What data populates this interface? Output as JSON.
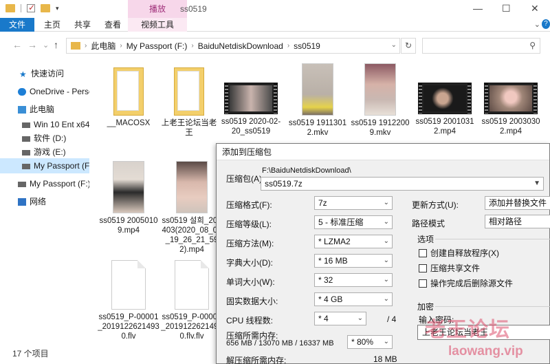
{
  "window": {
    "title": "ss0519",
    "context_tab": "播放",
    "min": "—",
    "max": "☐",
    "close": "✕"
  },
  "ribbon": {
    "tabs": [
      "文件",
      "主页",
      "共享",
      "查看",
      "视频工具"
    ],
    "help": "?",
    "chevron": "⌄"
  },
  "nav": {
    "back": "←",
    "forward": "→",
    "recent": "⌄",
    "up": "↑",
    "breadcrumbs": [
      "此电脑",
      "My Passport (F:)",
      "BaiduNetdiskDownload",
      "ss0519"
    ],
    "crumb_sep": "›",
    "dropdown": "⌄",
    "refresh": "↻",
    "search_icon": "⚲"
  },
  "sidebar": {
    "items": [
      {
        "label": "快速访问",
        "icon": "star-icon"
      },
      {
        "label": "OneDrive - Perso",
        "icon": "cloud-icon"
      },
      {
        "label": "此电脑",
        "icon": "pc-icon"
      },
      {
        "label": "Win 10 Ent x64 (",
        "icon": "drive-icon"
      },
      {
        "label": "软件 (D:)",
        "icon": "drive-icon"
      },
      {
        "label": "游戏 (E:)",
        "icon": "drive-icon"
      },
      {
        "label": "My Passport (F:)",
        "icon": "drive-icon",
        "selected": true
      },
      {
        "label": "My Passport (F:)",
        "icon": "drive-icon"
      },
      {
        "label": "网络",
        "icon": "network-icon"
      }
    ]
  },
  "files": [
    {
      "name": "__MACOSX",
      "kind": "folder"
    },
    {
      "name": "上老王论坛当老王",
      "kind": "folder"
    },
    {
      "name": "ss0519 2020-02-20_ss0519",
      "kind": "video-landscape"
    },
    {
      "name": "ss0519 19113012.mkv",
      "kind": "portrait"
    },
    {
      "name": "ss0519 19122009.mkv",
      "kind": "portrait"
    },
    {
      "name": "ss0519 20010312.mp4",
      "kind": "video-landscape"
    },
    {
      "name": "ss0519 20030302.mp4",
      "kind": "video-landscape"
    },
    {
      "name": "ss0519 20050109.mp4",
      "kind": "portrait"
    },
    {
      "name": "ss0519 설희_200403(2020_08_03_19_26_21_592).mp4",
      "kind": "portrait"
    },
    {
      "name": "ss0519_P-00001_20191226214930.flv",
      "kind": "document"
    },
    {
      "name": "ss0519_P-00001_20191226214930.flv.flv",
      "kind": "document"
    }
  ],
  "status": {
    "count": "17 个项目"
  },
  "dialog": {
    "title": "添加到压缩包",
    "archive_label": "压缩包(A)",
    "archive_path": "F:\\BaiduNetdiskDownload\\",
    "archive_name": "ss0519.7z",
    "format_label": "压缩格式(F):",
    "format_value": "7z",
    "level_label": "压缩等级(L):",
    "level_value": "5 - 标准压缩",
    "method_label": "压缩方法(M):",
    "method_value": "* LZMA2",
    "dict_label": "字典大小(D):",
    "dict_value": "* 16 MB",
    "word_label": "单词大小(W):",
    "word_value": "* 32",
    "solid_label": "固实数据大小:",
    "solid_value": "* 4 GB",
    "cpu_label": "CPU 线程数:",
    "cpu_value": "* 4",
    "cpu_total": "/ 4",
    "mem_label": "压缩所需内存:",
    "mem_values": "656 MB / 13070 MB / 16337 MB",
    "mem_percent": "* 80%",
    "decomp_label": "解压缩所需内存:",
    "decomp_value": "18 MB",
    "update_label": "更新方式(U):",
    "update_value": "添加并替换文件",
    "path_label": "路径模式",
    "path_value": "相对路径",
    "options_title": "选项",
    "options": [
      "创建自释放程序(X)",
      "压缩共享文件",
      "操作完成后删除源文件"
    ],
    "encrypt_title": "加密",
    "password_label": "输入密码:",
    "password_value": "上老王论坛当老王"
  },
  "watermark": {
    "cn": "老王论坛",
    "url": "laowang.vip"
  },
  "colors": {
    "accent": "#1979ca",
    "context_tab": "#f7d7ea",
    "selection": "#cce8ff",
    "folder": "#f3cf6b"
  }
}
